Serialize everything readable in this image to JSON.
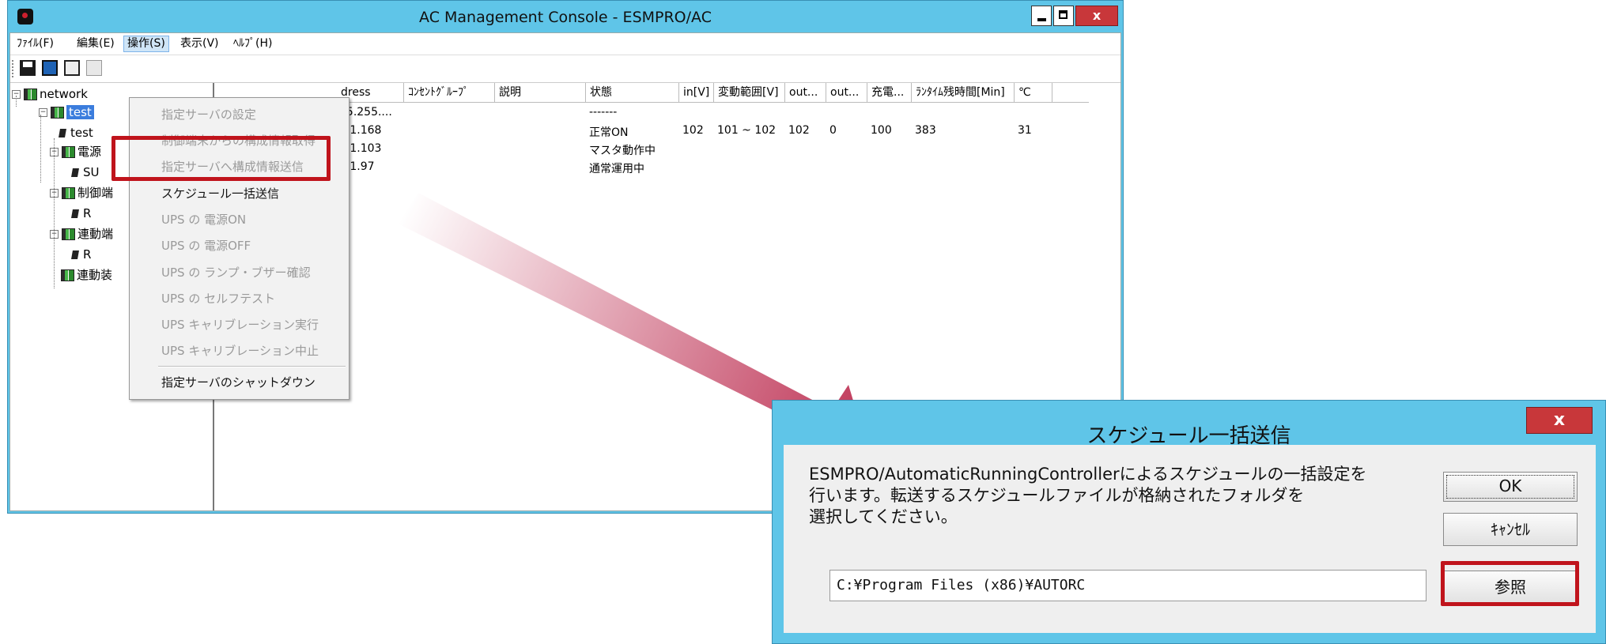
{
  "window": {
    "title": "AC Management Console - ESMPRO/AC",
    "close_label": "x"
  },
  "menubar": {
    "items": [
      "ﾌｧｲﾙ(F)",
      "編集(E)",
      "操作(S)",
      "表示(V)",
      "ﾍﾙﾌﾟ(H)"
    ]
  },
  "tree": {
    "nodes": [
      "network",
      "test",
      "test",
      "電源",
      "SU",
      "制御端",
      "R",
      "連動端",
      "R",
      "連動装"
    ]
  },
  "list": {
    "headers": [
      "dress",
      "ｺﾝｾﾝﾄｸﾞﾙｰﾌﾟ",
      "説明",
      "状態",
      "in[V]",
      "変動範囲[V]",
      "out...",
      "out...",
      "充電...",
      "ﾗﾝﾀｲﾑ残時間[Min]",
      "℃"
    ],
    "rows": [
      {
        "address": "55.255....",
        "status": "-------",
        "in": "",
        "range": "",
        "out1": "",
        "out2": "",
        "charge": "",
        "runtime": "",
        "temp": ""
      },
      {
        "address": "6.1.168",
        "status": "正常ON",
        "in": "102",
        "range": "101 ~ 102",
        "out1": "102",
        "out2": "0",
        "charge": "100",
        "runtime": "383",
        "temp": "31"
      },
      {
        "address": "6.1.103",
        "status": "マスタ動作中",
        "in": "",
        "range": "",
        "out1": "",
        "out2": "",
        "charge": "",
        "runtime": "",
        "temp": ""
      },
      {
        "address": "6.1.97",
        "status": "通常運用中",
        "in": "",
        "range": "",
        "out1": "",
        "out2": "",
        "charge": "",
        "runtime": "",
        "temp": ""
      }
    ]
  },
  "menu": {
    "items": [
      {
        "label": "指定サーバの設定",
        "enabled": false
      },
      {
        "label": "制御端末からの構成情報取得",
        "enabled": false
      },
      {
        "label": "指定サーバへ構成情報送信",
        "enabled": false
      },
      {
        "label": "スケジュール一括送信",
        "enabled": true
      },
      {
        "label": "UPS の 電源ON",
        "enabled": false
      },
      {
        "label": "UPS の 電源OFF",
        "enabled": false
      },
      {
        "label": "UPS の ランプ・ブザー確認",
        "enabled": false
      },
      {
        "label": "UPS の セルフテスト",
        "enabled": false
      },
      {
        "label": "UPS キャリブレーション実行",
        "enabled": false
      },
      {
        "label": "UPS キャリブレーション中止",
        "enabled": false
      },
      {
        "label": "指定サーバのシャットダウン",
        "enabled": true
      }
    ]
  },
  "dialog": {
    "title": "スケジュール一括送信",
    "close_label": "x",
    "message_lines": [
      "ESMPRO/AutomaticRunningControllerによるスケジュールの一括設定を",
      "行います。転送するスケジュールファイルが格納されたフォルダを",
      "選択してください。"
    ],
    "ok_label": "OK",
    "cancel_label": "ｷｬﾝｾﾙ",
    "browse_label": "参照",
    "path_value": "C:¥Program Files (x86)¥AUTORC"
  },
  "colors": {
    "titlebar": "#5fc5e8",
    "close": "#c8373a",
    "highlight": "#c0141c",
    "arrow": "#c0395a"
  }
}
